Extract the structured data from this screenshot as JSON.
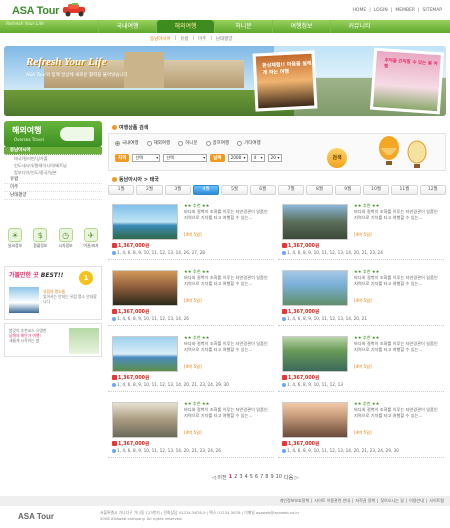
{
  "header": {
    "logo": "ASA Tour",
    "top_links": [
      "HOME",
      "|",
      "LOGIN",
      "|",
      "MEMBER",
      "|",
      "SITEMAP"
    ],
    "slogan": "Refresh Your Life",
    "nav": [
      {
        "label": "국내여행",
        "active": false
      },
      {
        "label": "해외여행",
        "active": true
      },
      {
        "label": "허니문",
        "active": false
      },
      {
        "label": "여행정보",
        "active": false
      },
      {
        "label": "커뮤니티",
        "active": false
      }
    ],
    "subnav": [
      {
        "label": "동남아시아",
        "active": true
      },
      {
        "label": "|",
        "active": false
      },
      {
        "label": "유럽",
        "active": false
      },
      {
        "label": "|",
        "active": false
      },
      {
        "label": "미주",
        "active": false
      },
      {
        "label": "|",
        "active": false
      },
      {
        "label": "남태평양",
        "active": false
      }
    ]
  },
  "banner": {
    "title": "Refresh Your Life",
    "subtitle": "ASA Tour와 함께 일상에 새로운 활력을 불어넣습니다",
    "photo1_caption": "환상체험!! 마음을 설레게 하는 여행",
    "photo2_caption": "추억을 간직할 수 있는 봄 여행"
  },
  "sidebar": {
    "title": "해외여행",
    "subtitle": "Oversea Travel",
    "items": [
      {
        "label": "동남아시아",
        "selected": true
      },
      {
        "label": "유럽",
        "selected": false
      },
      {
        "label": "미주",
        "selected": false
      },
      {
        "label": "남태평양",
        "selected": false
      }
    ],
    "sub_items": [
      "태국/필리핀/싱가폴",
      "인도네시아/말레이시아/베트남",
      "캄보디아/인도/중국/일본"
    ],
    "quick_icons": [
      {
        "label": "날씨정보",
        "icon": "weather-icon",
        "glyph": "☀"
      },
      {
        "label": "환율정보",
        "icon": "exchange-icon",
        "glyph": "$"
      },
      {
        "label": "시차정보",
        "icon": "clock-icon",
        "glyph": "◷"
      },
      {
        "label": "여권/비자",
        "icon": "passport-icon",
        "glyph": "✈"
      }
    ],
    "best": {
      "title": "가볼만한 곳",
      "highlight": "BEST!!",
      "badge": "1",
      "text_title": "유럽의 명소들",
      "text": "잊어서는 안되는 유럽 명소 안내합니다"
    },
    "ad": {
      "title": "봄맞이 추천코스 유명한",
      "highlight": "남해의 해안가 여행!",
      "text": "새롭게 시작하는 봄"
    }
  },
  "search": {
    "label": "여행상품 검색",
    "radio_options": [
      {
        "label": "국내여행",
        "selected": true
      },
      {
        "label": "해외여행",
        "selected": false
      },
      {
        "label": "허니문",
        "selected": false
      },
      {
        "label": "골프여행",
        "selected": false
      },
      {
        "label": "기타여행",
        "selected": false
      }
    ],
    "region_label": "지역",
    "region_value": "선택",
    "region_value2": "선택",
    "date_label": "날짜",
    "year": "2008",
    "month": "4",
    "day": "20",
    "button": "검색"
  },
  "section": {
    "label": "동남아시아 > 태국",
    "months": [
      "1월",
      "2월",
      "3월",
      "4월",
      "5월",
      "6월",
      "7월",
      "8월",
      "9월",
      "10월",
      "11월",
      "12월"
    ],
    "active_month_index": 3
  },
  "tours": [
    {
      "stars": "★★ 추천 ★★",
      "desc": "바다와 절벽이 조화를 이루는 자연경관이 일품인 지역으로 기차를 타고 여행할 수 있는...",
      "badge": "[4박 5일]",
      "price": "1,367,000원",
      "dates": "1, 4, 6, 8, 9, 10, 11, 12, 13, 14, 26, 27, 28"
    },
    {
      "stars": "★★ 추천 ★★",
      "desc": "바다와 절벽이 조화를 이루는 자연경관이 일품인 지역으로 기차를 타고 여행할 수 있는...",
      "badge": "[4박 5일]",
      "price": "1,367,000원",
      "dates": "1, 4, 6, 8, 9, 10, 11, 12, 13, 14, 20, 21, 23, 24"
    },
    {
      "stars": "★★ 추천 ★★",
      "desc": "바다와 절벽이 조화를 이루는 자연경관이 일품인 지역으로 기차를 타고 여행할 수 있는...",
      "badge": "[4박 5일]",
      "price": "1,367,000원",
      "dates": "1, 4, 6, 8, 9, 10, 11, 12, 13, 14, 26"
    },
    {
      "stars": "★★ 추천 ★★",
      "desc": "바다와 절벽이 조화를 이루는 자연경관이 일품인 지역으로 기차를 타고 여행할 수 있는...",
      "badge": "[4박 5일]",
      "price": "1,367,000원",
      "dates": "1, 4, 6, 8, 9, 10, 11, 12, 13, 14, 20, 21"
    },
    {
      "stars": "★★ 추천 ★★",
      "desc": "바다와 절벽이 조화를 이루는 자연경관이 일품인 지역으로 기차를 타고 여행할 수 있는...",
      "badge": "[4박 5일]",
      "price": "1,367,000원",
      "dates": "1, 4, 6, 8, 9, 10, 11, 12, 13, 14, 20, 21, 23, 24, 29, 30"
    },
    {
      "stars": "★★ 추천 ★★",
      "desc": "바다와 절벽이 조화를 이루는 자연경관이 일품인 지역으로 기차를 타고 여행할 수 있는...",
      "badge": "[4박 5일]",
      "price": "1,367,000원",
      "dates": "1, 4, 6, 8, 9, 10, 11, 12, 13"
    },
    {
      "stars": "★★ 추천 ★★",
      "desc": "바다와 절벽이 조화를 이루는 자연경관이 일품인 지역으로 기차를 타고 여행할 수 있는...",
      "badge": "[4박 5일]",
      "price": "1,367,000원",
      "dates": "1, 4, 6, 8, 9, 10, 11, 12, 13, 14, 20, 21, 23, 24, 26"
    },
    {
      "stars": "★★ 추천 ★★",
      "desc": "바다와 절벽이 조화를 이루는 자연경관이 일품인 지역으로 기차를 타고 여행할 수 있는...",
      "badge": "[4박 5일]",
      "price": "1,367,000원",
      "dates": "1, 4, 6, 8, 9, 10, 11, 12, 13, 14, 20, 21, 23, 24, 29, 30"
    }
  ],
  "pager": {
    "prev": "◁ 이전",
    "pages": [
      "1",
      "2",
      "3",
      "4",
      "5",
      "6",
      "7",
      "8",
      "9",
      "10"
    ],
    "current": "1",
    "next": "다음 ▷"
  },
  "footer": {
    "links": [
      "개인정보보호정책",
      "|",
      "사이트 이용관련 안내",
      "|",
      "저작권 정책",
      "|",
      "찾아오시는 길",
      "|",
      "이용안내",
      "|",
      "사이트맵"
    ],
    "logo": "ASA Tour",
    "line1": "서울특별시 가나다구 가나동 123번지 | 전화상담 01234-5678-9 | 팩스 01234-5678 | 이메일 asaweb@asaweb.co.kr",
    "line2": "2008 ASAweb company. All rights reserved."
  }
}
